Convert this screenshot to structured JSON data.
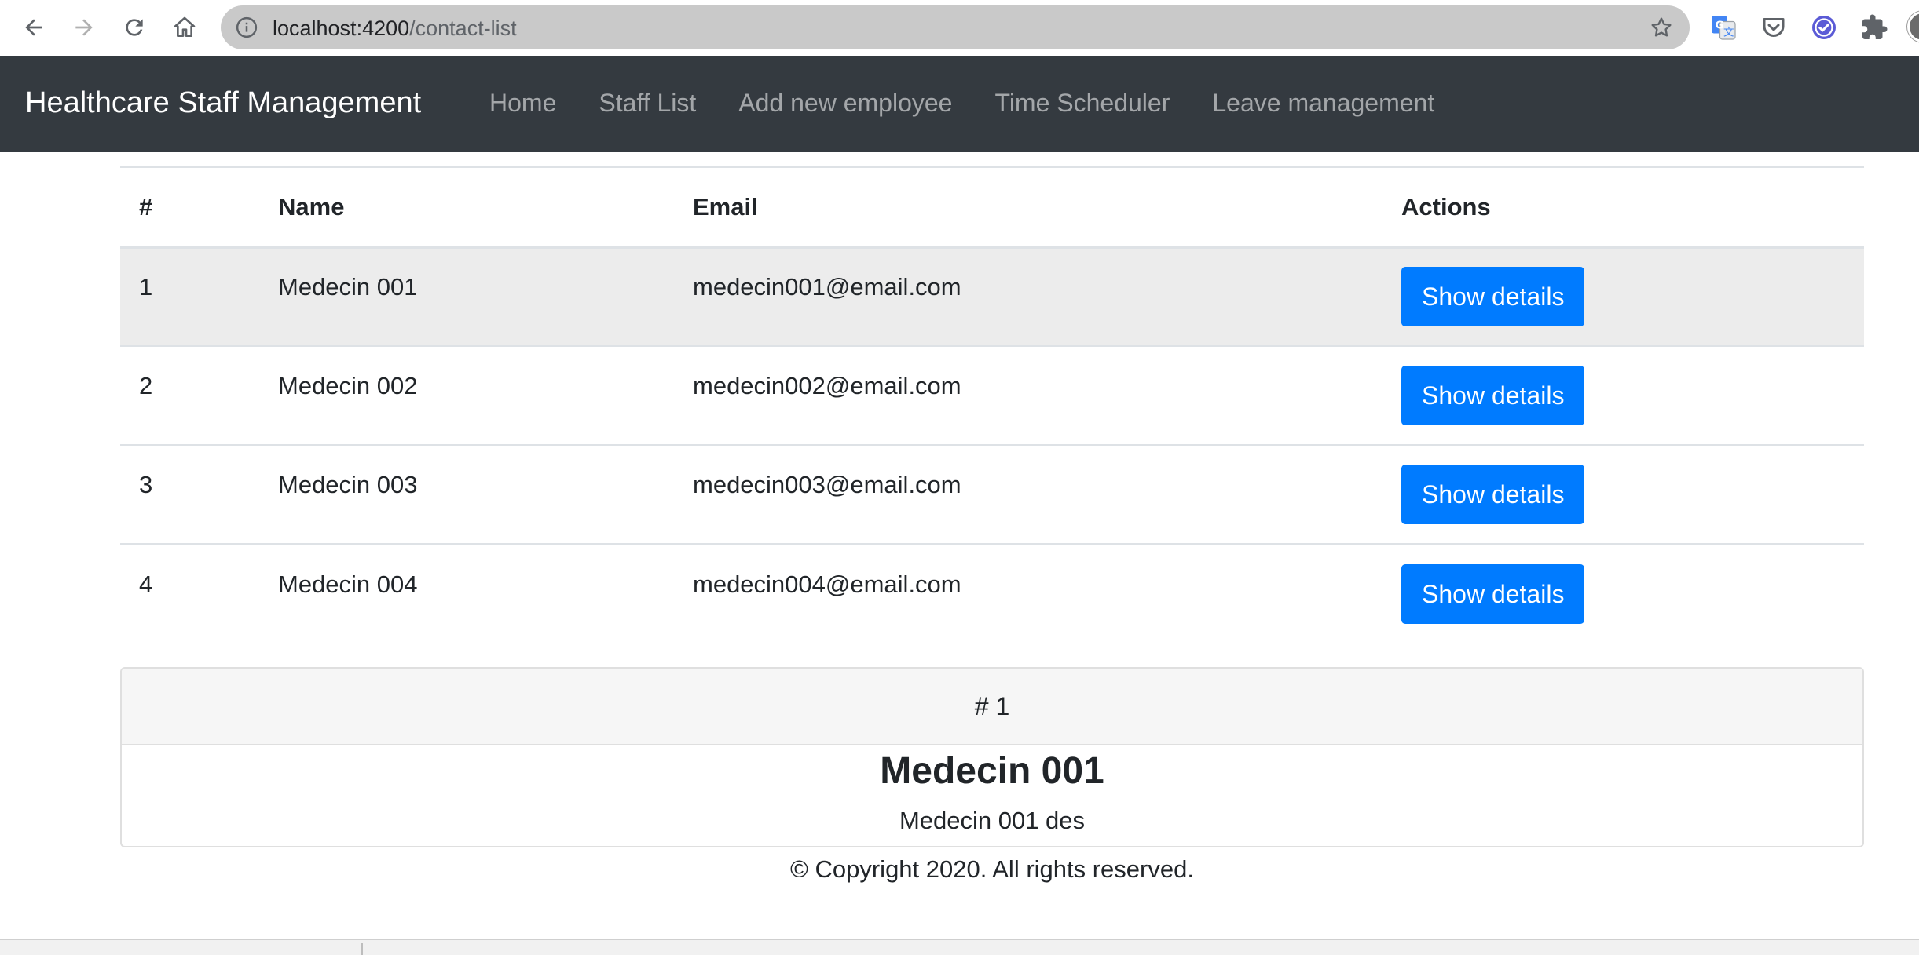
{
  "browser": {
    "url_host": "localhost:4200",
    "url_path": "/contact-list",
    "back_icon": "back-arrow-icon",
    "forward_icon": "forward-arrow-icon",
    "reload_icon": "reload-icon",
    "home_icon": "home-icon",
    "extensions": [
      "google-translate-icon",
      "pocket-icon",
      "check-shield-icon",
      "puzzle-extensions-icon"
    ]
  },
  "navbar": {
    "brand": "Healthcare Staff Management",
    "links": [
      {
        "label": "Home"
      },
      {
        "label": "Staff List"
      },
      {
        "label": "Add new employee"
      },
      {
        "label": "Time Scheduler"
      },
      {
        "label": "Leave management"
      }
    ]
  },
  "table": {
    "headers": [
      "#",
      "Name",
      "Email",
      "Actions"
    ],
    "rows": [
      {
        "num": "1",
        "name": "Medecin 001",
        "email": "medecin001@email.com",
        "action": "Show details",
        "active": true
      },
      {
        "num": "2",
        "name": "Medecin 002",
        "email": "medecin002@email.com",
        "action": "Show details",
        "active": false
      },
      {
        "num": "3",
        "name": "Medecin 003",
        "email": "medecin003@email.com",
        "action": "Show details",
        "active": false
      },
      {
        "num": "4",
        "name": "Medecin 004",
        "email": "medecin004@email.com",
        "action": "Show details",
        "active": false
      }
    ]
  },
  "details": {
    "header": "# 1",
    "title": "Medecin 001",
    "description": "Medecin 001 des"
  },
  "footer": {
    "text": "© Copyright 2020. All rights reserved."
  },
  "colors": {
    "navbar_bg": "#343a40",
    "button_primary": "#007bff",
    "active_row": "#ececec"
  }
}
